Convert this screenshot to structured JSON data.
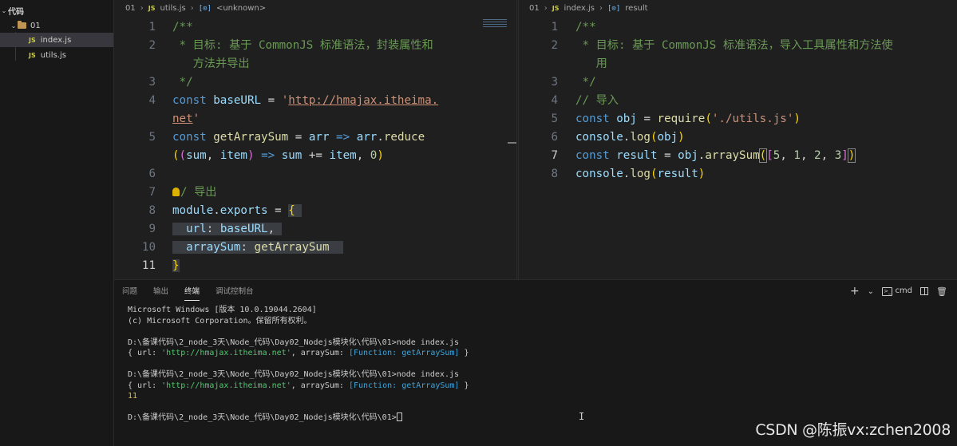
{
  "explorer": {
    "root_label": "代码",
    "folder_label": "01",
    "files": [
      "index.js",
      "utils.js"
    ],
    "js_badge": "JS"
  },
  "left_editor": {
    "breadcrumb": {
      "folder": "01",
      "file": "utils.js",
      "symbol": "<unknown>"
    },
    "line_numbers": [
      "1",
      "2",
      "3",
      "4",
      "5",
      "6",
      "7",
      "8",
      "9",
      "10",
      "11"
    ]
  },
  "right_editor": {
    "breadcrumb": {
      "folder": "01",
      "file": "index.js",
      "symbol": "result"
    },
    "line_numbers": [
      "1",
      "2",
      "3",
      "4",
      "5",
      "6",
      "7",
      "8"
    ]
  },
  "panel": {
    "tabs": [
      "问题",
      "输出",
      "终端",
      "调试控制台"
    ],
    "active_tab": "终端",
    "actions": {
      "add": "+",
      "dropdown": "⌄",
      "shell": "cmd"
    }
  },
  "terminal_lines": {
    "l1": "Microsoft Windows [版本 10.0.19044.2604]",
    "l2": "(c) Microsoft Corporation。保留所有权利。",
    "prompt": "D:\\备课代码\\2_node_3天\\Node_代码\\Day02_Nodejs模块化\\代码\\01>",
    "cmd": "node index.js",
    "obj_prefix": "{ url: ",
    "obj_url": "'http://hmajax.itheima.net'",
    "obj_mid": ", arraySum: ",
    "obj_fn": "[Function: getArraySum]",
    "obj_suffix": " }",
    "result": "11"
  },
  "watermark": "CSDN @陈振vx:zchen2008"
}
